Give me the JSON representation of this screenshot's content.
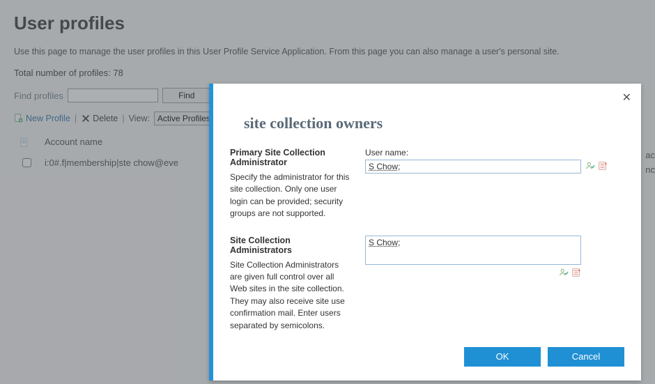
{
  "header": {
    "title": "User profiles",
    "description": "Use this page to manage the user profiles in this User Profile Service Application. From this page you can also manage a user's personal site.",
    "total_label": "Total number of profiles:",
    "total_value": "78"
  },
  "find": {
    "label": "Find profiles",
    "input_value": "",
    "button_label": "Find"
  },
  "toolbar": {
    "new_profile": "New Profile",
    "delete": "Delete",
    "view_label": "View:",
    "view_selected": "Active Profiles"
  },
  "table": {
    "col_account": "Account name",
    "rows": [
      {
        "account": "i:0#.f|membership|ste        chow@eve"
      }
    ],
    "right_cut_header": "ac",
    "right_cut_value": "nc"
  },
  "dialog": {
    "title": "site collection owners",
    "close_symbol": "✕",
    "primary": {
      "header": "Primary Site Collection Administrator",
      "body": "Specify the administrator for this site collection. Only one user login can be provided; security groups are not supported.",
      "field_label": "User name:",
      "value": "S         Chow;"
    },
    "secondary": {
      "header": "Site Collection Administrators",
      "body": "Site Collection Administrators are given full control over all Web sites in the site collection. They may also receive site use confirmation mail. Enter users separated by semicolons.",
      "value": "S         Chow;"
    },
    "ok": "OK",
    "cancel": "Cancel"
  },
  "icons": {
    "page": "page-icon",
    "new": "plus-page-icon",
    "delete": "x-icon",
    "check_names": "check-names-icon",
    "browse": "address-book-icon"
  }
}
